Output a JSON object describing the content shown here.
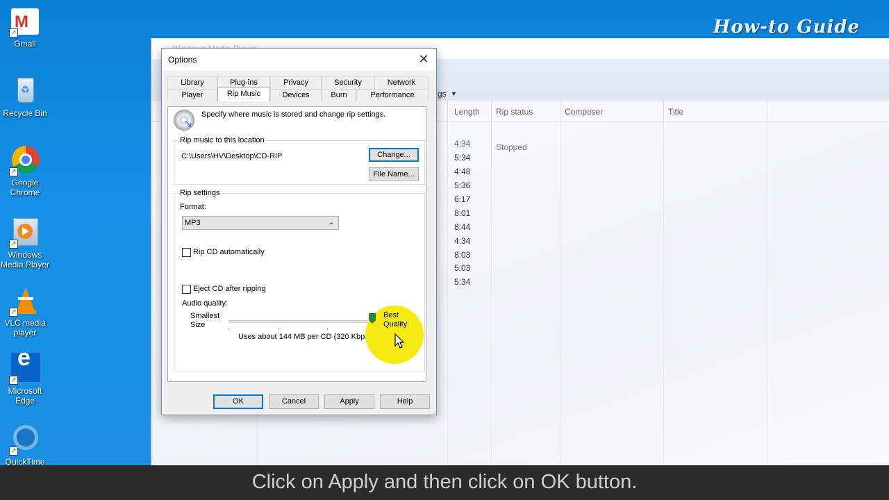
{
  "desktop": {
    "icons": [
      {
        "label": "Gmail"
      },
      {
        "label": "Recycle Bin"
      },
      {
        "label": "Google Chrome"
      },
      {
        "label": "Windows Media Player"
      },
      {
        "label": "VLC media player"
      },
      {
        "label": "Microsoft Edge"
      },
      {
        "label": "QuickTime Player"
      }
    ],
    "watermark": "How-to Guide"
  },
  "wmp": {
    "title": "Windows Media Player",
    "menu_fragment": "gs",
    "columns": [
      "Length",
      "Rip status",
      "Composer",
      "Title"
    ],
    "first_status": "Stopped",
    "lengths": [
      "4:34",
      "5:34",
      "4:48",
      "5:36",
      "6:17",
      "8:01",
      "8:44",
      "4:34",
      "8:03",
      "5:03",
      "5:34"
    ]
  },
  "dialog": {
    "title": "Options",
    "tabs_row1": [
      "Library",
      "Plug-ins",
      "Privacy",
      "Security",
      "Network"
    ],
    "tabs_row2": [
      "Player",
      "Rip Music",
      "Devices",
      "Burn",
      "Performance"
    ],
    "active_tab": "Rip Music",
    "intro": "Specify where music is stored and change rip settings.",
    "location_group": "Rip music to this location",
    "location_path": "C:\\Users\\HV\\Desktop\\CD-RIP",
    "change_button": "Change...",
    "filename_button": "File Name...",
    "settings_group": "Rip settings",
    "format_label": "Format:",
    "format_value": "MP3",
    "rip_auto_label": "Rip CD automatically",
    "eject_label": "Eject CD after ripping",
    "audio_quality_label": "Audio quality:",
    "smallest_label_1": "Smallest",
    "smallest_label_2": "Size",
    "best_label_1": "Best",
    "best_label_2": "Quality",
    "usage_text": "Uses about 144 MB per CD (320 Kbps)",
    "quality_level": 1.0,
    "ok": "OK",
    "cancel": "Cancel",
    "apply": "Apply",
    "help": "Help"
  },
  "caption": "Click on Apply and then click on OK button."
}
